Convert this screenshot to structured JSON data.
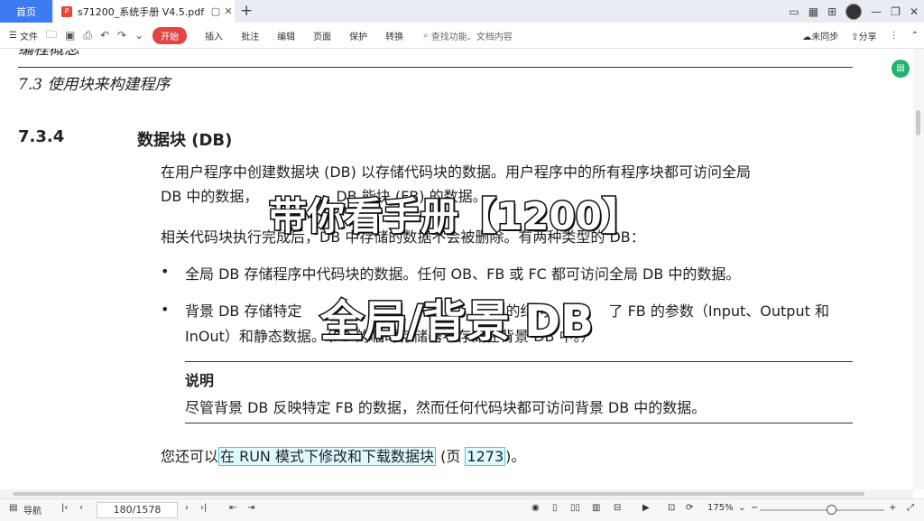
{
  "titlebar": {
    "home_tab": "首页",
    "doc_tab": "s71200_系统手册 V4.5.pdf",
    "new_tab": "+"
  },
  "menubar": {
    "file": "文件",
    "start": "开始",
    "items": [
      "插入",
      "批注",
      "编辑",
      "页面",
      "保护",
      "转换"
    ],
    "search_placeholder": "查找功能、文档内容",
    "sync": "未同步",
    "share": "分享"
  },
  "document": {
    "header_cut": "编程概念",
    "chapter": "7.3 使用块来构建程序",
    "section_number": "7.3.4",
    "section_title": "数据块 (DB)",
    "para1_line1": "在用户程序中创建数据块 (DB) 以存储代码块的数据。用户程序中的所有程序块都可访问全局",
    "para1_line2": "DB 中的数据，",
    "para1_line2_tail": "DB        能块 (FB) 的数据。",
    "para2": "相关代码块执行完成后，DB 中存储的数据不会被删除。有两种类型的 DB：",
    "bullet1": "全局 DB 存储程序中代码块的数据。任何 OB、FB 或 FC 都可访问全局 DB 中的数据。",
    "bullet2_line1_a": "背景 DB 存储特定",
    "bullet2_line1_b": "的结构",
    "bullet2_line1_c": "了 FB 的参数（Input、Output 和",
    "bullet2_line2": "InOut）和静态数据。（FB 的临时存储器不存储在背景 DB 中。）",
    "note_title": "说明",
    "note_text": "尽管背景 DB 反映特定 FB 的数据，然而任何代码块都可访问背景 DB 中的数据。",
    "last_prefix": "您还可以",
    "last_link": "在 RUN 模式下修改和下载数据块",
    "last_mid": " (页 ",
    "last_page": "1273",
    "last_suffix": ")。"
  },
  "overlay": {
    "line1": "带你看手册【1200】",
    "line2": "全局/背景 DB"
  },
  "statusbar": {
    "nav": "导航",
    "page": "180/1578",
    "zoom": "175%"
  }
}
